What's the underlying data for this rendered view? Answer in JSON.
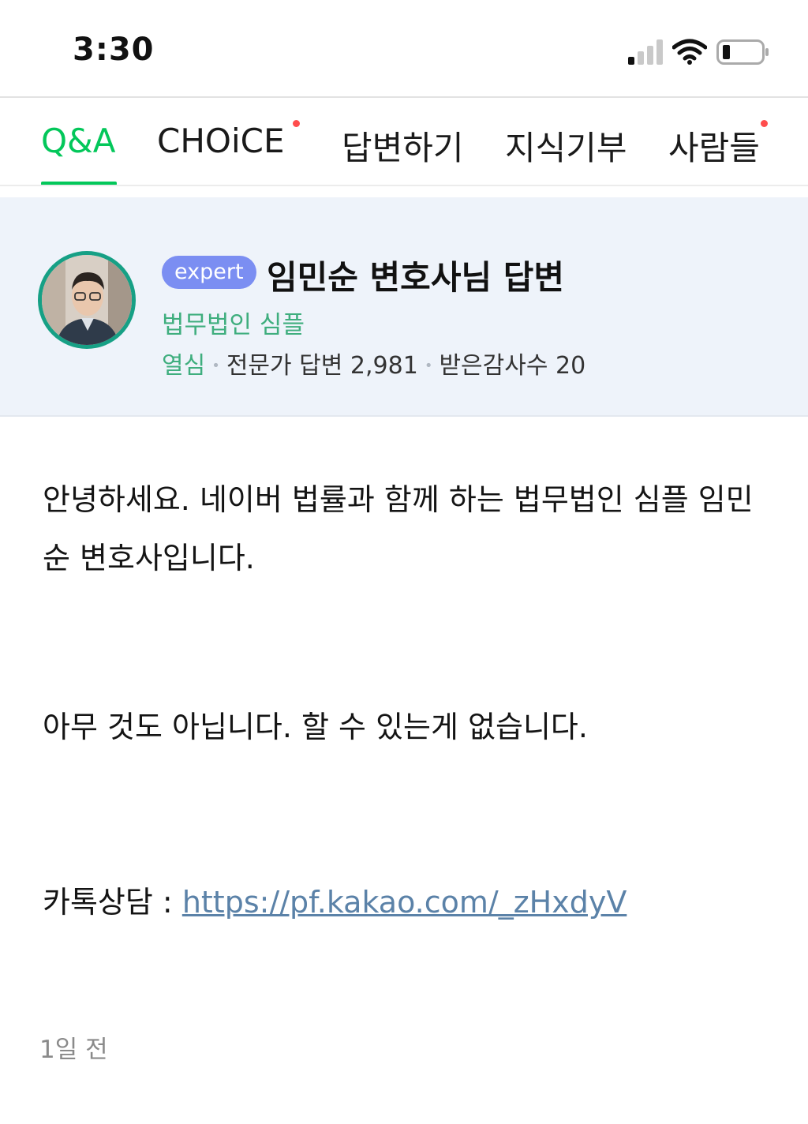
{
  "status_bar": {
    "time": "3:30",
    "icons": [
      "signal-icon",
      "wifi-icon",
      "battery-icon"
    ]
  },
  "tabs": [
    {
      "label": "Q&A",
      "active": true,
      "badge_dot": false
    },
    {
      "label": "CHOiCE",
      "active": false,
      "badge_dot": true
    },
    {
      "label": "답변하기",
      "active": false,
      "badge_dot": false
    },
    {
      "label": "지식기부",
      "active": false,
      "badge_dot": false
    },
    {
      "label": "사람들",
      "active": false,
      "badge_dot": true
    }
  ],
  "expert": {
    "badge": "expert",
    "title": "임민순 변호사님 답변",
    "firm": "법무법인 심플",
    "level": "열심",
    "answers_label": "전문가 답변",
    "answers_count": "2,981",
    "thanks_label": "받은감사수",
    "thanks_count": "20"
  },
  "answer": {
    "paragraph1": "안녕하세요. 네이버 법률과 함께 하는 법무법인 심플 임민순 변호사입니다.",
    "paragraph2": "아무 것도 아닙니다. 할 수 있는게 없습니다.",
    "kakao_label": "카톡상담 : ",
    "kakao_link": "https://pf.kakao.com/_zHxdyV"
  },
  "posted": "1일 전",
  "colors": {
    "accent": "#03c75a",
    "expert_badge": "#7b8ef2",
    "firm_text": "#3fae7e",
    "card_bg": "#eef3fa",
    "link": "#5b82a8"
  }
}
